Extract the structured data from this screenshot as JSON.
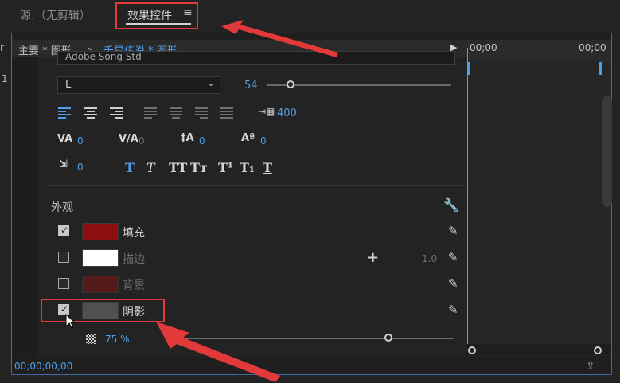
{
  "tabs": {
    "source": "源:（无剪辑）",
    "effect_controls": "效果控件",
    "menu_icon": "≡"
  },
  "clip_header": {
    "main": "主要 * 图形",
    "chevron": "⌄",
    "sequence": "千星传说 * 图形",
    "play": "▶"
  },
  "text": {
    "font": "Adobe Song Std",
    "style": "L",
    "style_chevron": "⌄",
    "size": "54",
    "tracking": "400",
    "metrics": [
      "0",
      "0",
      "0",
      "0"
    ],
    "baseline": "0",
    "style_buttons": [
      "T",
      "T",
      "TT",
      "Tт",
      "T¹",
      "T₁",
      "T"
    ]
  },
  "appearance": {
    "title": "外观",
    "items": [
      {
        "label": "填充",
        "checked": true,
        "color": "#8e0f0f"
      },
      {
        "label": "描边",
        "checked": false,
        "color": "#ffffff",
        "value": "1.0",
        "plus": "+"
      },
      {
        "label": "背景",
        "checked": false,
        "color": "#6b1818"
      },
      {
        "label": "阴影",
        "checked": true,
        "color": "#505050"
      }
    ],
    "opacity": "75 %"
  },
  "timeline": {
    "start": "00;00",
    "end": "00;00"
  },
  "timecode": "00;00;00;00",
  "left_edge": [
    "r",
    "1"
  ],
  "colors": {
    "accent": "#4f9ee8",
    "highlight": "#e23a3a"
  }
}
